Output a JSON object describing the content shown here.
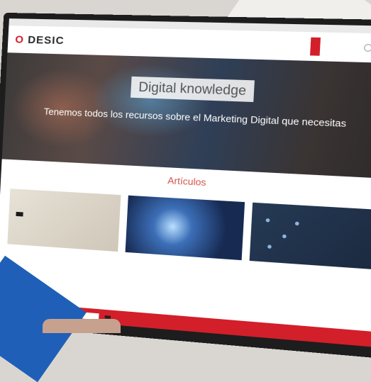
{
  "brand": {
    "logo_left": "O",
    "logo_right": "DESIC"
  },
  "topbar": {
    "links": [
      "",
      "",
      "",
      "",
      ""
    ]
  },
  "nav": {
    "items": [
      "",
      "",
      "",
      "",
      "",
      "",
      ""
    ]
  },
  "hero": {
    "title": "Digital knowledge",
    "subtitle": "Tenemos todos los recursos sobre el Marketing Digital que necesitas"
  },
  "articles": {
    "heading": "Artículos",
    "description": "",
    "cards": [
      {
        "image_tag": "",
        "text": ""
      },
      {
        "image_tag": "",
        "text": ""
      },
      {
        "image_tag": "",
        "text": ""
      }
    ]
  },
  "footer": {
    "input_placeholder": "",
    "button_label": "",
    "link_label": ""
  },
  "colors": {
    "accent": "#d21f2a",
    "heading": "#d2564d"
  }
}
